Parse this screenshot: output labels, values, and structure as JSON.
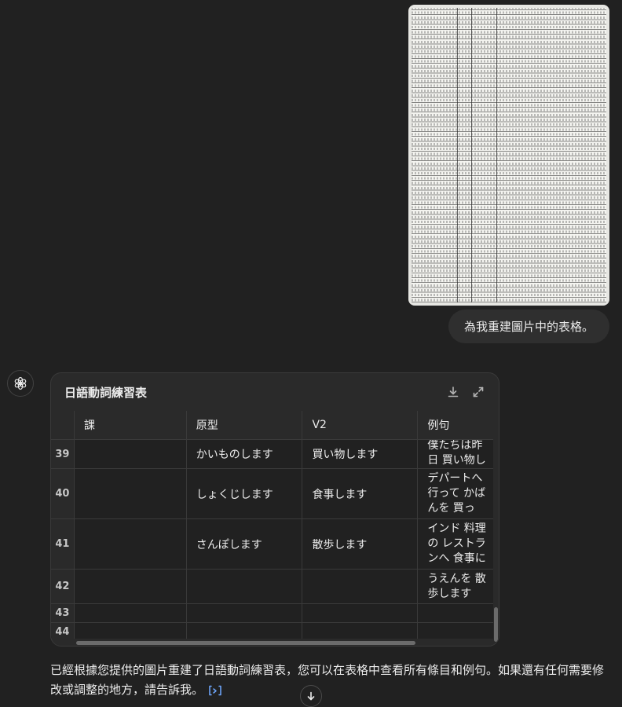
{
  "chat": {
    "user_message": "為我重建圖片中的表格。",
    "assistant_message": "已經根據您提供的圖片重建了日語動詞練習表，您可以在表格中查看所有條目和例句。如果還有任何需要修改或調整的地方，請告訴我。"
  },
  "table_panel": {
    "title": "日語動詞練習表",
    "columns": [
      "課",
      "原型",
      "V2",
      "例句"
    ],
    "rows": [
      {
        "n": "39",
        "lesson": "",
        "base": "かいものします",
        "v2": "買い物します",
        "example": "僕たちは昨日 買い物しました"
      },
      {
        "n": "40",
        "lesson": "",
        "base": "しょくじします",
        "v2": "食事します",
        "example": "デパートへ 行って かばんを 買って、 行きます"
      },
      {
        "n": "41",
        "lesson": "",
        "base": "さんぽします",
        "v2": "散歩します",
        "example": "インド 料理の レストランへ 食事に 行きます"
      },
      {
        "n": "42",
        "lesson": "",
        "base": "",
        "v2": "",
        "example": "うえんを 散歩します"
      },
      {
        "n": "43",
        "lesson": "",
        "base": "",
        "v2": "",
        "example": ""
      },
      {
        "n": "44",
        "lesson": "",
        "base": "",
        "v2": "",
        "example": ""
      }
    ]
  },
  "icons": {
    "download": "download-icon",
    "expand": "expand-icon",
    "assistant_logo": "openai-logo-icon",
    "citation": "citation-icon",
    "scroll_down": "arrow-down-icon"
  }
}
